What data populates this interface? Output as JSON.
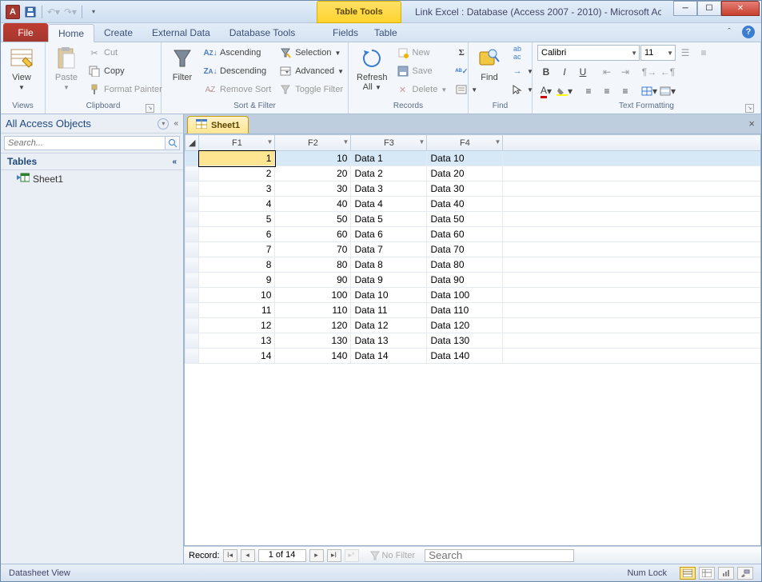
{
  "titlebar": {
    "title": "Link Excel : Database (Access 2007 - 2010) -  Microsoft Ac...",
    "contextual": "Table Tools"
  },
  "tabs": {
    "file": "File",
    "list": [
      "Home",
      "Create",
      "External Data",
      "Database Tools"
    ],
    "sub": [
      "Fields",
      "Table"
    ],
    "activeIndex": 0
  },
  "ribbon": {
    "views": {
      "view": "View",
      "group": "Views"
    },
    "clipboard": {
      "paste": "Paste",
      "cut": "Cut",
      "copy": "Copy",
      "fmtpainter": "Format Painter",
      "group": "Clipboard"
    },
    "sortfilter": {
      "filter": "Filter",
      "asc": "Ascending",
      "desc": "Descending",
      "removesort": "Remove Sort",
      "selection": "Selection",
      "advanced": "Advanced",
      "toggle": "Toggle Filter",
      "group": "Sort & Filter"
    },
    "records": {
      "refresh": "Refresh\nAll",
      "new": "New",
      "save": "Save",
      "delete": "Delete",
      "sigma": "Σ",
      "spell": "",
      "more": "",
      "group": "Records"
    },
    "find": {
      "find": "Find",
      "group": "Find"
    },
    "text": {
      "font": "Calibri",
      "size": "11",
      "group": "Text Formatting"
    }
  },
  "nav": {
    "title": "All Access Objects",
    "search_placeholder": "Search...",
    "group": "Tables",
    "items": [
      {
        "label": "Sheet1"
      }
    ]
  },
  "doc": {
    "tab": "Sheet1"
  },
  "columns": [
    "F1",
    "F2",
    "F3",
    "F4"
  ],
  "rows": [
    {
      "f1": "1",
      "f2": "10",
      "f3": "Data 1",
      "f4": "Data 10"
    },
    {
      "f1": "2",
      "f2": "20",
      "f3": "Data 2",
      "f4": "Data 20"
    },
    {
      "f1": "3",
      "f2": "30",
      "f3": "Data 3",
      "f4": "Data 30"
    },
    {
      "f1": "4",
      "f2": "40",
      "f3": "Data 4",
      "f4": "Data 40"
    },
    {
      "f1": "5",
      "f2": "50",
      "f3": "Data 5",
      "f4": "Data 50"
    },
    {
      "f1": "6",
      "f2": "60",
      "f3": "Data 6",
      "f4": "Data 60"
    },
    {
      "f1": "7",
      "f2": "70",
      "f3": "Data 7",
      "f4": "Data 70"
    },
    {
      "f1": "8",
      "f2": "80",
      "f3": "Data 8",
      "f4": "Data 80"
    },
    {
      "f1": "9",
      "f2": "90",
      "f3": "Data 9",
      "f4": "Data 90"
    },
    {
      "f1": "10",
      "f2": "100",
      "f3": "Data 10",
      "f4": "Data 100"
    },
    {
      "f1": "11",
      "f2": "110",
      "f3": "Data 11",
      "f4": "Data 110"
    },
    {
      "f1": "12",
      "f2": "120",
      "f3": "Data 12",
      "f4": "Data 120"
    },
    {
      "f1": "13",
      "f2": "130",
      "f3": "Data 13",
      "f4": "Data 130"
    },
    {
      "f1": "14",
      "f2": "140",
      "f3": "Data 14",
      "f4": "Data 140"
    }
  ],
  "recordnav": {
    "label": "Record:",
    "pos": "1 of 14",
    "nofilter": "No Filter",
    "search": "Search"
  },
  "statusbar": {
    "left": "Datasheet View",
    "numlock": "Num Lock"
  }
}
